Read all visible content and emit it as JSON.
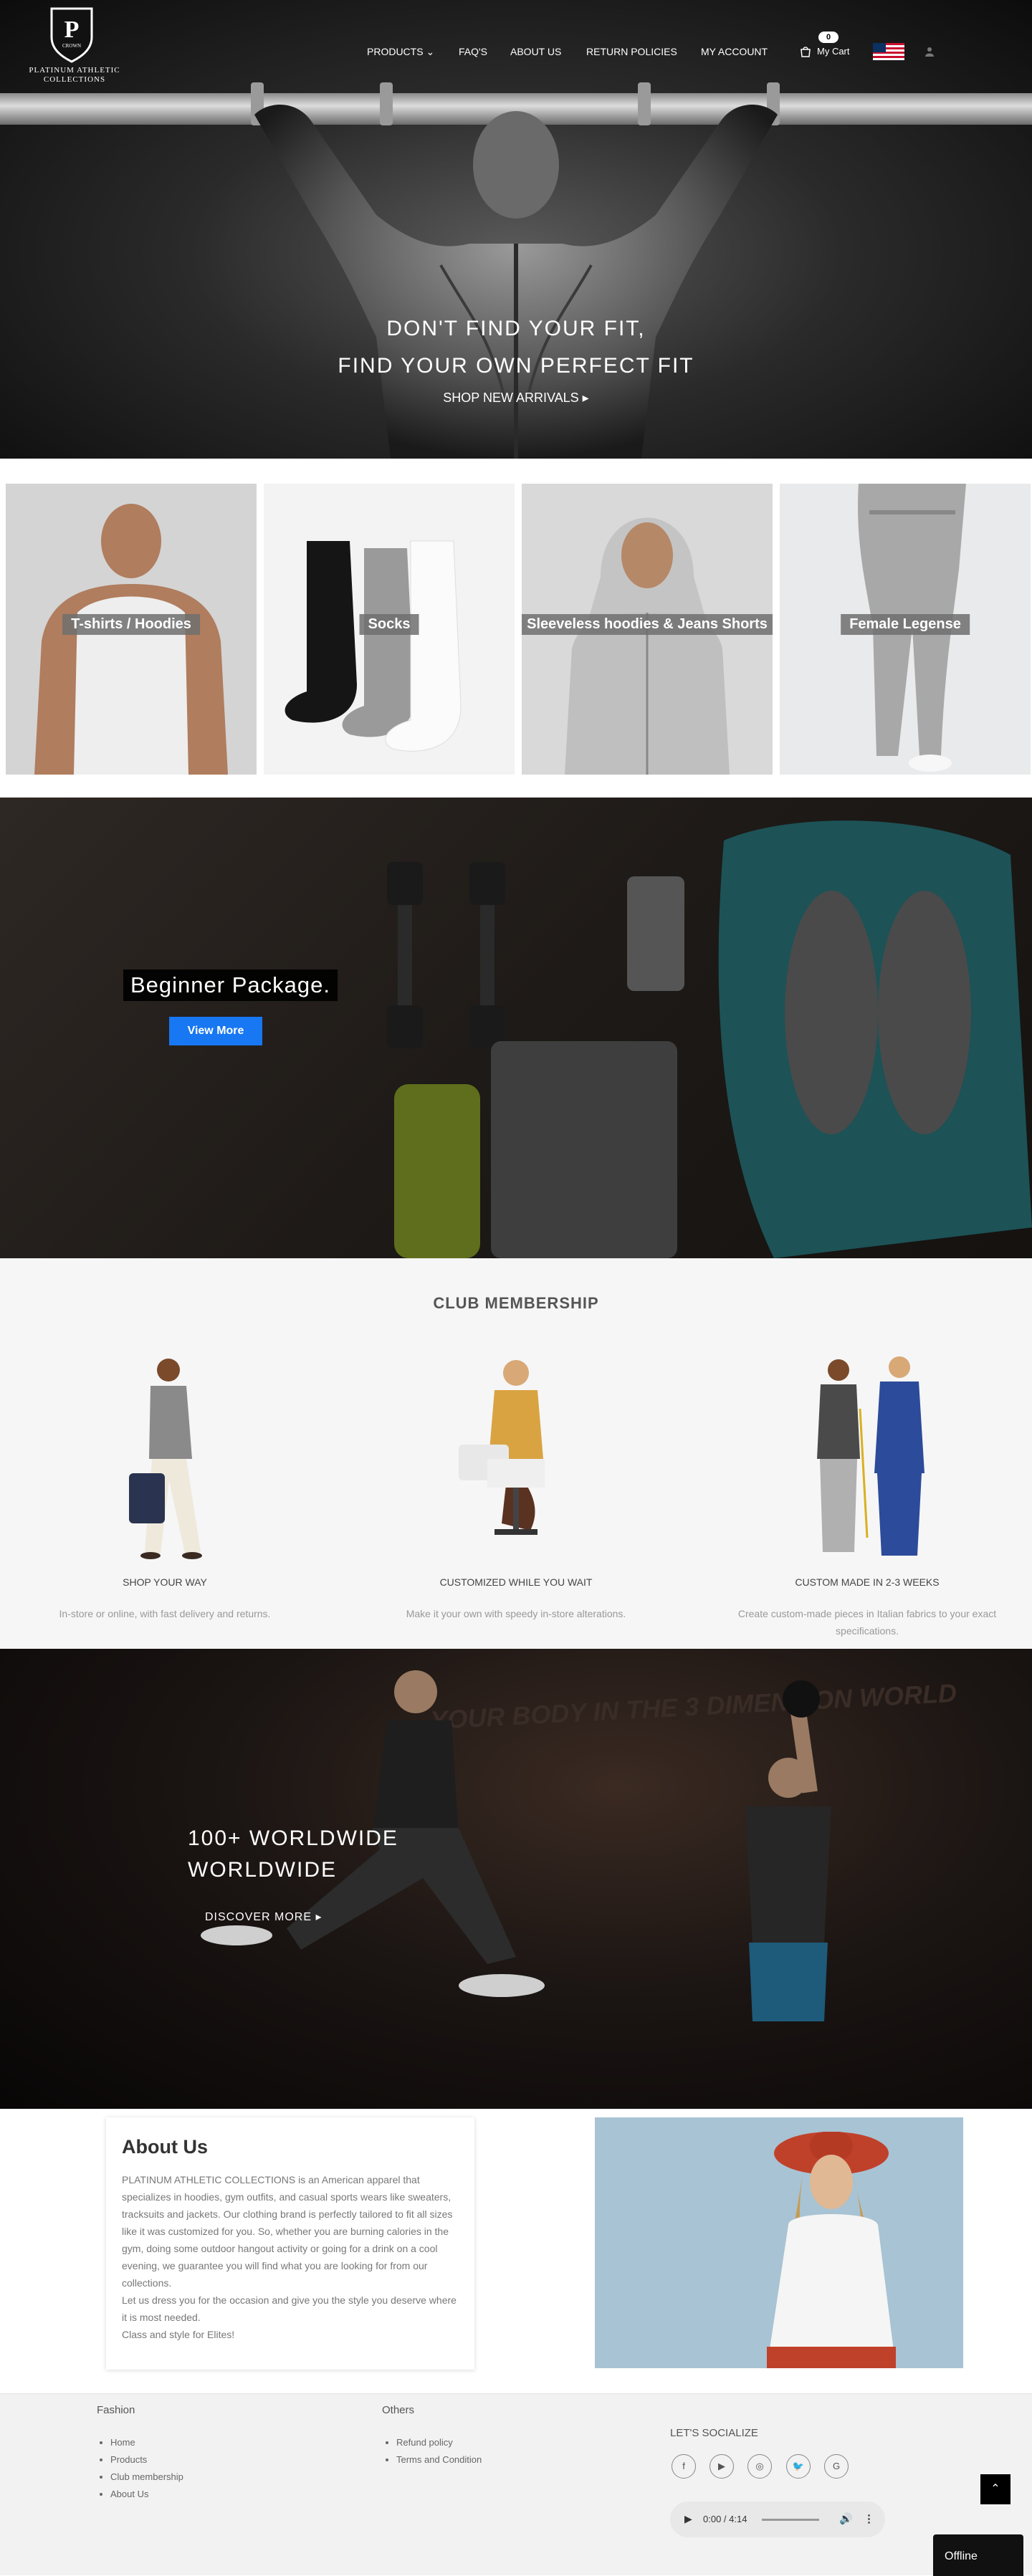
{
  "brand": {
    "logo_letter": "P",
    "logo_sub": "CROWN",
    "line1": "PLATINUM ATHLETIC",
    "line2": "COLLECTIONS"
  },
  "nav": {
    "items": [
      {
        "label": "PRODUCTS",
        "has_dropdown": true
      },
      {
        "label": "FAQ'S"
      },
      {
        "label": "ABOUT US"
      },
      {
        "label": "RETURN POLICIES"
      },
      {
        "label": "MY ACCOUNT"
      }
    ],
    "cart": {
      "count": "0",
      "label": "My Cart"
    }
  },
  "hero": {
    "line1": "DON'T FIND YOUR FIT,",
    "line2": "FIND YOUR OWN PERFECT FIT",
    "cta": "SHOP NEW ARRIVALS"
  },
  "categories": [
    {
      "label": "T-shirts / Hoodies"
    },
    {
      "label": "Socks"
    },
    {
      "label": "Sleeveless hoodies & Jeans Shorts"
    },
    {
      "label": "Female Legense"
    }
  ],
  "beginner": {
    "title": "Beginner Package.",
    "button": "View More"
  },
  "club": {
    "title": "CLUB MEMBERSHIP",
    "features": [
      {
        "title": "SHOP YOUR WAY",
        "desc": "In-store or online, with fast delivery and returns."
      },
      {
        "title": "CUSTOMIZED WHILE YOU WAIT",
        "desc": "Make it your own with speedy in-store alterations."
      },
      {
        "title": "CUSTOM MADE IN 2-3 WEEKS",
        "desc": "Create custom-made pieces in Italian fabrics to your exact specifications."
      }
    ]
  },
  "world": {
    "line1": "100+ WORLDWIDE",
    "line2": "WORLDWIDE",
    "cta": "DISCOVER MORE",
    "wall_text": "YOUR BODY IN THE 3 DIMENSION WORLD"
  },
  "about": {
    "title": "About Us",
    "text": "PLATINUM ATHLETIC COLLECTIONS is an American apparel that specializes in hoodies, gym outfits, and casual sports wears like sweaters, tracksuits and jackets. Our clothing brand is perfectly tailored to fit all sizes like it was customized for you. So, whether you are burning calories in the gym, doing some outdoor hangout activity or going for a drink on a cool evening, we guarantee you will find what you are looking for from our collections.",
    "text2": "Let us dress you for the occasion and give you the style you deserve where it is most needed.",
    "text3": "Class and style for Elites!"
  },
  "footer": {
    "fashion": {
      "title": "Fashion",
      "links": [
        "Home",
        "Products",
        "Club membership",
        "About Us"
      ]
    },
    "others": {
      "title": "Others",
      "links": [
        "Refund policy",
        "Terms and Condition"
      ]
    },
    "social_title": "LET'S SOCIALIZE",
    "social": [
      "f",
      "▶",
      "◎",
      "🐦",
      "G"
    ],
    "player_time": "0:00 / 4:14",
    "offline": "Offline"
  },
  "colors": {
    "accent": "#1877f2",
    "dark": "#111111",
    "club_bg": "#f6f6f6"
  }
}
